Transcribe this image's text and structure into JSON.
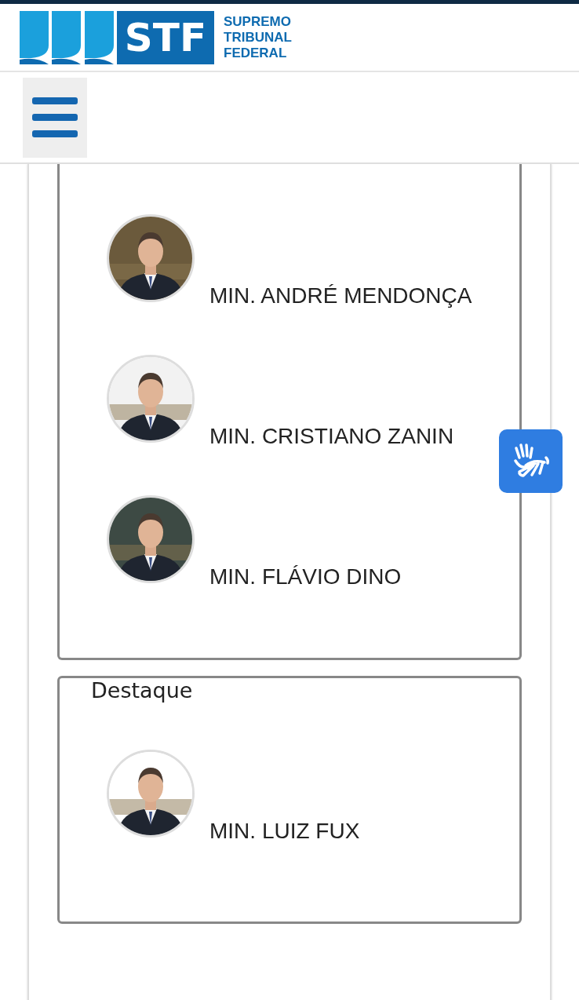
{
  "header": {
    "logo": {
      "mark": "STF",
      "name_lines": [
        "SUPREMO",
        "TRIBUNAL",
        "FEDERAL"
      ]
    }
  },
  "sections": [
    {
      "ministers": [
        {
          "name": "MIN. ANDRÉ MENDONÇA"
        },
        {
          "name": "MIN. CRISTIANO ZANIN"
        },
        {
          "name": "MIN. FLÁVIO DINO"
        }
      ]
    },
    {
      "title": "Destaque",
      "ministers": [
        {
          "name": "MIN. LUIZ FUX"
        }
      ]
    }
  ]
}
